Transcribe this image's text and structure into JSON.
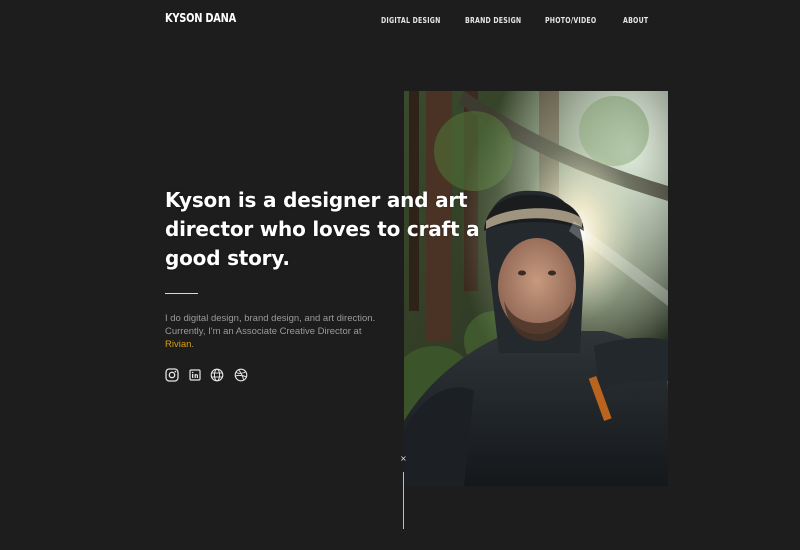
{
  "header": {
    "logo": "KYSON DANA",
    "nav": [
      {
        "label": "DIGITAL DESIGN"
      },
      {
        "label": "BRAND DESIGN"
      },
      {
        "label": "PHOTO/VIDEO"
      },
      {
        "label": "ABOUT"
      }
    ]
  },
  "hero": {
    "headline_lines": [
      "Kyson is a designer and art",
      "director who loves to craft a",
      "good story."
    ],
    "bio_line1": "I do digital design, brand design, and art direction.",
    "bio_line2": "Currently, I'm an Associate Creative Director at",
    "bio_link": "Rivian",
    "bio_end": "."
  },
  "socials": [
    {
      "icon": "instagram-icon"
    },
    {
      "icon": "linkedin-icon"
    },
    {
      "icon": "website-globe-icon"
    },
    {
      "icon": "dribbble-icon"
    }
  ],
  "scroll_marker": "×",
  "colors": {
    "background": "#1d1d1d",
    "text": "#ffffff",
    "muted_text": "#9a9a9a",
    "link": "#d4a017"
  }
}
